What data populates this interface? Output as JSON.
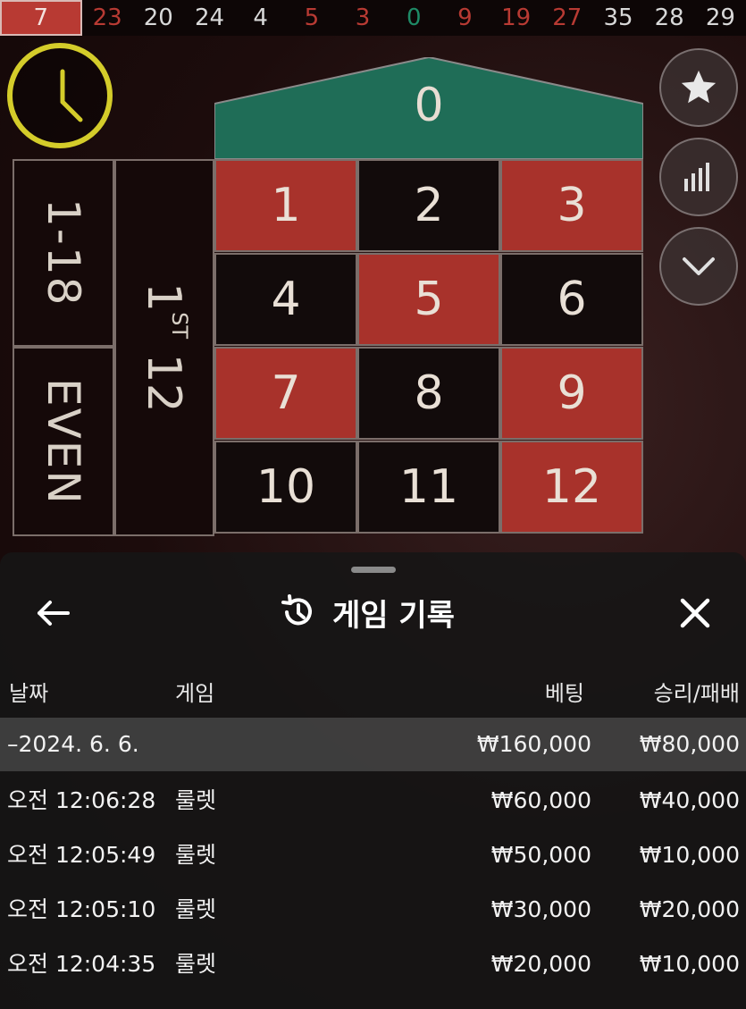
{
  "history": {
    "numbers": [
      {
        "v": "7",
        "color": "red"
      },
      {
        "v": "23",
        "color": "red"
      },
      {
        "v": "20",
        "color": "black"
      },
      {
        "v": "24",
        "color": "black"
      },
      {
        "v": "4",
        "color": "black"
      },
      {
        "v": "5",
        "color": "red"
      },
      {
        "v": "3",
        "color": "red"
      },
      {
        "v": "0",
        "color": "green"
      },
      {
        "v": "9",
        "color": "red"
      },
      {
        "v": "19",
        "color": "red"
      },
      {
        "v": "27",
        "color": "red"
      },
      {
        "v": "35",
        "color": "black"
      },
      {
        "v": "28",
        "color": "black"
      },
      {
        "v": "29",
        "color": "black"
      }
    ]
  },
  "table": {
    "zero": "0",
    "numbers": [
      {
        "v": "1",
        "color": "red"
      },
      {
        "v": "2",
        "color": "black"
      },
      {
        "v": "3",
        "color": "red"
      },
      {
        "v": "4",
        "color": "black"
      },
      {
        "v": "5",
        "color": "red"
      },
      {
        "v": "6",
        "color": "black"
      },
      {
        "v": "7",
        "color": "red"
      },
      {
        "v": "8",
        "color": "black"
      },
      {
        "v": "9",
        "color": "red"
      },
      {
        "v": "10",
        "color": "black"
      },
      {
        "v": "11",
        "color": "black"
      },
      {
        "v": "12",
        "color": "red"
      }
    ],
    "low_label": "1-18",
    "even_label": "EVEN",
    "dozen_num": "1",
    "dozen_sup": "ST",
    "dozen_12": "12"
  },
  "colors": {
    "red": "#a8322b",
    "black": "#120b0b",
    "green": "#1f6d57",
    "timer": "#d4cc2a"
  },
  "side_buttons": [
    "star-icon",
    "stats-icon",
    "chevron-down-icon"
  ],
  "sheet": {
    "title": "게임 기록",
    "columns": {
      "date": "날짜",
      "game": "게임",
      "bet": "베팅",
      "winloss": "승리/패배"
    },
    "date_group": {
      "date": "–2024. 6. 6.",
      "bet": "₩160,000",
      "winloss": "₩80,000"
    },
    "rows": [
      {
        "time": "오전 12:06:28",
        "game": "룰렛",
        "bet": "₩60,000",
        "winloss": "₩40,000"
      },
      {
        "time": "오전 12:05:49",
        "game": "룰렛",
        "bet": "₩50,000",
        "winloss": "₩10,000"
      },
      {
        "time": "오전 12:05:10",
        "game": "룰렛",
        "bet": "₩30,000",
        "winloss": "₩20,000"
      },
      {
        "time": "오전 12:04:35",
        "game": "룰렛",
        "bet": "₩20,000",
        "winloss": "₩10,000"
      }
    ]
  }
}
